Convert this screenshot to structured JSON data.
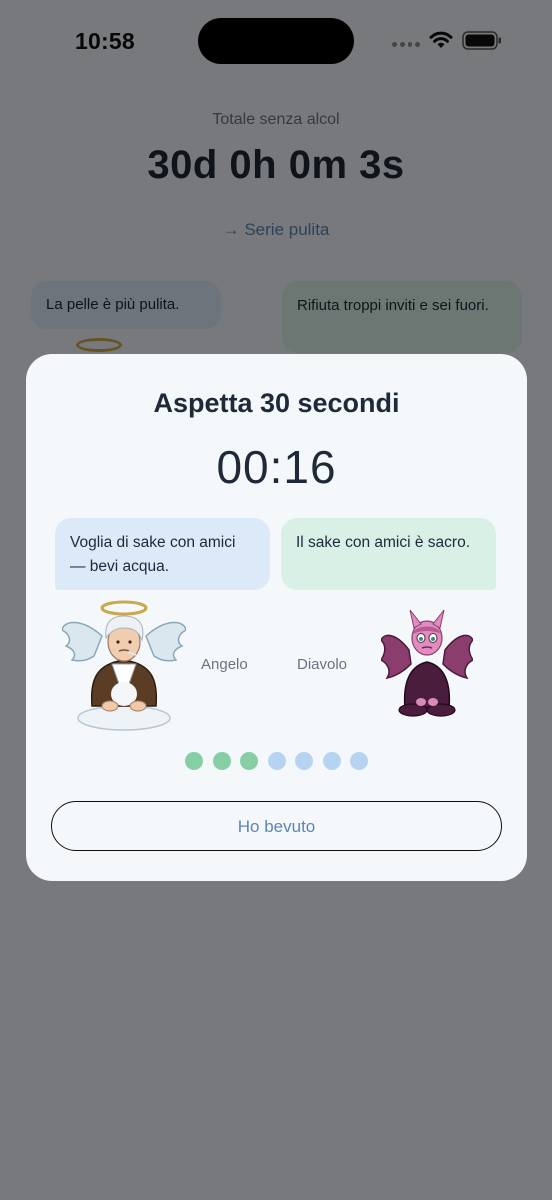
{
  "status_bar": {
    "time": "10:58",
    "icons": [
      "signal-icon",
      "wifi-icon",
      "battery-icon"
    ]
  },
  "background": {
    "total_label": "Totale senza alcol",
    "total_value": "30d 0h 0m 3s",
    "streak_link": "→ Serie pulita",
    "bubble_left": "La pelle è più pulita.",
    "bubble_right": "Rifiuta troppi inviti e sei fuori."
  },
  "modal": {
    "title": "Aspetta 30 secondi",
    "countdown": "00:16",
    "angel_bubble": "Voglia di sake con amici — bevi acqua.",
    "devil_bubble": "Il sake con amici è sacro.",
    "angel_label": "Angelo",
    "devil_label": "Diavolo",
    "progress": {
      "completed": 3,
      "total": 7
    },
    "drank_button": "Ho bevuto"
  },
  "colors": {
    "dot_done": "#86cfa5",
    "dot_pending": "#b7d3f2",
    "accent_link": "#5b86b3"
  }
}
